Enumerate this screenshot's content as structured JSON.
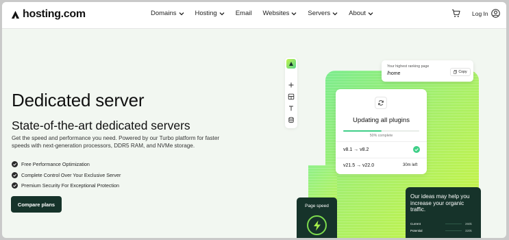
{
  "brand": {
    "name": "hosting.com"
  },
  "nav": {
    "items": [
      {
        "label": "Domains",
        "has_dropdown": true
      },
      {
        "label": "Hosting",
        "has_dropdown": true
      },
      {
        "label": "Email",
        "has_dropdown": false
      },
      {
        "label": "Websites",
        "has_dropdown": true
      },
      {
        "label": "Servers",
        "has_dropdown": true
      },
      {
        "label": "About",
        "has_dropdown": true
      }
    ],
    "cart_icon": "cart-icon",
    "login_label": "Log In",
    "user_icon": "user-circle-icon"
  },
  "hero": {
    "title": "Dedicated server",
    "subtitle": "State-of-the-art dedicated servers",
    "description": "Get the speed and performance you need. Powered by our Turbo platform for faster speeds with next-generation processors, DDR5 RAM, and NVMe storage.",
    "features": [
      "Free Performance Optimization",
      "Complete Control Over Your Exclusive Server",
      "Premium Security For Exceptional Protection"
    ],
    "cta_label": "Compare plans"
  },
  "illustration": {
    "rank_card": {
      "label": "Your highest ranking page",
      "value": "/home",
      "copy_label": "Copy"
    },
    "update_card": {
      "title": "Updating all plugins",
      "progress": 0.5,
      "progress_label": "50% complete",
      "rows": [
        {
          "text": "v8.1 → v8.2",
          "status": "done"
        },
        {
          "text": "v21.5 → v22.0",
          "status": "30m left"
        }
      ]
    },
    "speed_card": {
      "label": "Page speed"
    },
    "ideas_card": {
      "text": "Our ideas may help you increase your organic traffic.",
      "metrics": [
        {
          "label": "Current",
          "value": "260k"
        },
        {
          "label": "Potential",
          "value": "320k"
        }
      ]
    }
  },
  "colors": {
    "dark_green": "#16332a",
    "accent_green": "#3fcf88",
    "lime": "#cdf43f",
    "page_bg": "#f2f7f1"
  }
}
